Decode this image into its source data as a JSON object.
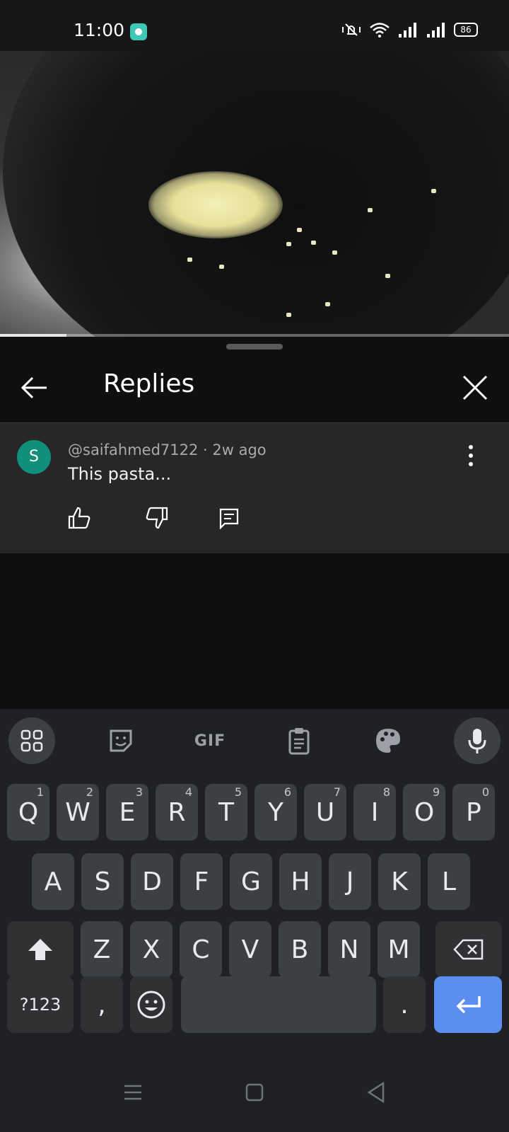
{
  "status_bar": {
    "time": "11:00",
    "battery": "86",
    "icons": [
      "chat-app-icon",
      "vibrate-icon",
      "wifi-icon",
      "signal-icon",
      "signal-icon",
      "battery-icon"
    ]
  },
  "video": {
    "progress_fraction": 0.13
  },
  "panel": {
    "title": "Replies",
    "back_icon": "back-arrow-icon",
    "close_icon": "close-icon"
  },
  "comment": {
    "avatar_letter": "S",
    "meta": "@saifahmed7122 · 2w ago",
    "text": "This pasta...",
    "avatar_color": "#128f7a",
    "actions": [
      "like-icon",
      "dislike-icon",
      "reply-icon"
    ]
  },
  "keyboard": {
    "toolbar": {
      "apps_icon": "apps-grid-icon",
      "sticker_icon": "sticker-icon",
      "gif_label": "GIF",
      "clipboard_icon": "clipboard-icon",
      "theme_icon": "palette-icon",
      "mic_icon": "microphone-icon"
    },
    "row1": [
      {
        "label": "Q",
        "hint": "1"
      },
      {
        "label": "W",
        "hint": "2"
      },
      {
        "label": "E",
        "hint": "3"
      },
      {
        "label": "R",
        "hint": "4"
      },
      {
        "label": "T",
        "hint": "5"
      },
      {
        "label": "Y",
        "hint": "6"
      },
      {
        "label": "U",
        "hint": "7"
      },
      {
        "label": "I",
        "hint": "8"
      },
      {
        "label": "O",
        "hint": "9"
      },
      {
        "label": "P",
        "hint": "0"
      }
    ],
    "row2": [
      "A",
      "S",
      "D",
      "F",
      "G",
      "H",
      "J",
      "K",
      "L"
    ],
    "row3": [
      "Z",
      "X",
      "C",
      "V",
      "B",
      "N",
      "M"
    ],
    "symbols_label": "?123",
    "comma": ",",
    "period": ".",
    "accent_color": "#5c8ef2"
  },
  "nav_bar": {
    "icons": [
      "recents-icon",
      "home-icon",
      "back-icon"
    ]
  }
}
